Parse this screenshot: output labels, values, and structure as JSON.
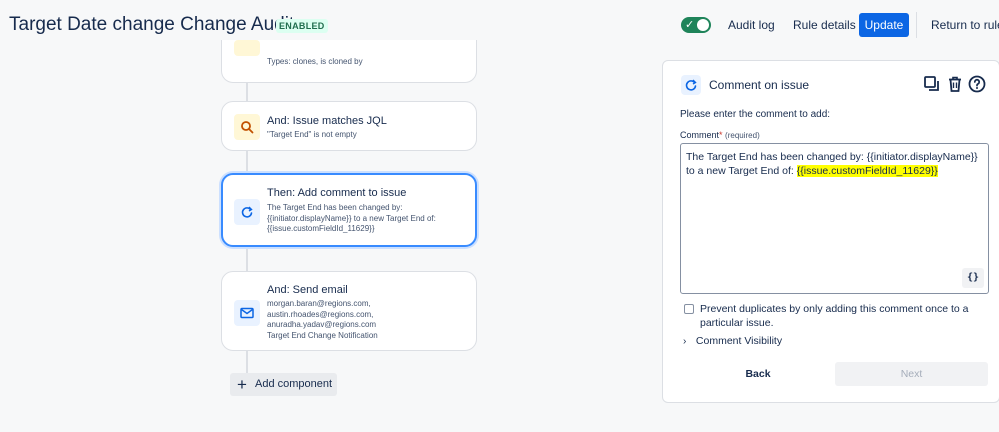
{
  "header": {
    "title": "Target Date change Change Audit",
    "badge": "ENABLED",
    "audit_log": "Audit log",
    "rule_details": "Rule details",
    "update": "Update",
    "return_to_rules": "Return to rules"
  },
  "flow": {
    "partial_card": {
      "desc": "Types: clones, is cloned by"
    },
    "cards": [
      {
        "title": "And: Issue matches JQL",
        "desc": "\"Target End\" is not empty",
        "icon": "search-icon"
      },
      {
        "title": "Then: Add comment to issue",
        "desc": "The Target End has been changed by: {{initiator.displayName}} to a new Target End of: {{issue.customFieldId_11629}}",
        "icon": "comment-refresh-icon"
      },
      {
        "title": "And: Send email",
        "desc": "morgan.baran@regions.com, austin.rhoades@regions.com, anuradha.yadav@regions.com Target End Change Notification",
        "icon": "email-icon"
      }
    ],
    "add_component": "Add component"
  },
  "panel": {
    "title": "Comment on issue",
    "prompt": "Please enter the comment to add:",
    "field_label": "Comment",
    "required_mark": "*",
    "required_text": "(required)",
    "comment_part1": "The Target End has been changed by: {{initiator.displayName}} to a new Target End of: ",
    "comment_part2": "{{issue.customFieldId_11629}}",
    "smart_value_button": "{}",
    "prevent_duplicates": "Prevent duplicates by only adding this comment once to a particular issue.",
    "comment_visibility": "Comment Visibility",
    "back": "Back",
    "next": "Next"
  },
  "colors": {
    "primary": "#0c66e4",
    "toggle_on": "#1f845a",
    "highlight": "#ffff00",
    "selected_border": "#388bff"
  }
}
